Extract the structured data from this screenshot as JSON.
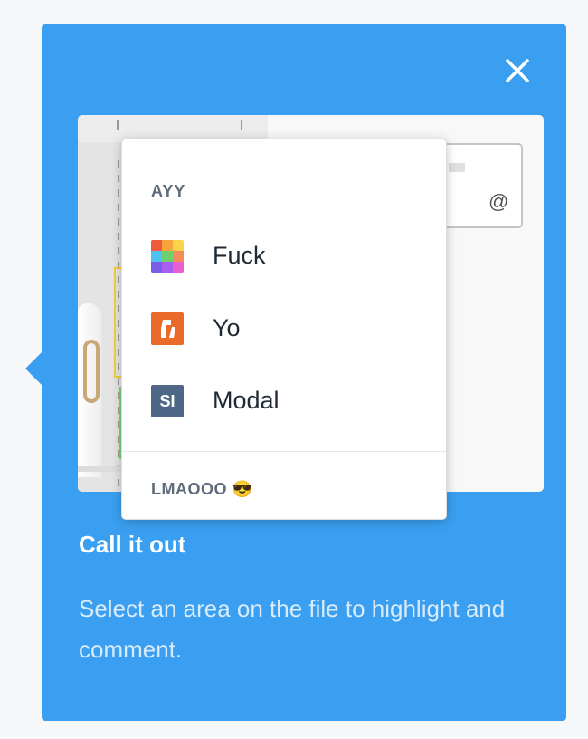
{
  "popover": {
    "close_icon": "close-icon",
    "background_color": "#3a9ff0",
    "title": "Call it out",
    "description": "Select an area on the file to highlight and comment."
  },
  "preview": {
    "input_icon": "at-sign-icon",
    "input_symbol": "@"
  },
  "dropdown": {
    "section_header": "AYY",
    "items": [
      {
        "label": "Fuck",
        "icon": "colorful-grid-app-icon"
      },
      {
        "label": "Yo",
        "icon": "orange-logo-app-icon"
      },
      {
        "label": "Modal",
        "icon": "si-app-icon",
        "icon_text": "SI"
      }
    ],
    "footer_label": "LMAOOO 😎"
  }
}
